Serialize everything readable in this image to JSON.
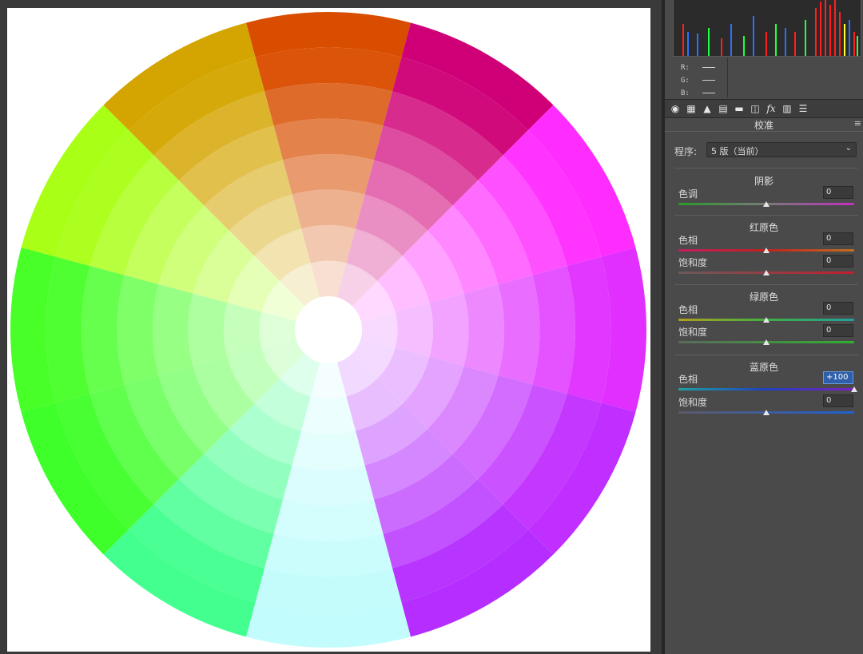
{
  "wheel": {
    "segments": 12,
    "rings": 8,
    "colors": [
      {
        "hue": "orange-red",
        "hex": "#d94d00"
      },
      {
        "hue": "magenta-red",
        "hex": "#cf0077"
      },
      {
        "hue": "magenta",
        "hex": "#ff2cff"
      },
      {
        "hue": "violet",
        "hex": "#e02fff"
      },
      {
        "hue": "purple",
        "hex": "#c02fff"
      },
      {
        "hue": "purple-blue",
        "hex": "#b52dff"
      },
      {
        "hue": "light-cyan",
        "hex": "#c2fcfc"
      },
      {
        "hue": "mint",
        "hex": "#42ff8f"
      },
      {
        "hue": "green",
        "hex": "#3fff2a"
      },
      {
        "hue": "green-2",
        "hex": "#48ff28"
      },
      {
        "hue": "yellow-green",
        "hex": "#aaff17"
      },
      {
        "hue": "mustard",
        "hex": "#d4a500"
      }
    ]
  },
  "histogram": {
    "colors": [
      "#ff2020",
      "#2f6fff",
      "#20ff40",
      "#ffff30"
    ]
  },
  "readout": {
    "r": "R:",
    "g": "G:",
    "b": "B:"
  },
  "toolbar": {
    "icons": [
      "aperture-icon",
      "grid-icon",
      "mountain-icon",
      "split-toning-icon",
      "bars-icon",
      "lens-icon",
      "fx-icon",
      "film-icon",
      "sliders-icon"
    ],
    "glyphs": [
      "◉",
      "▦",
      "▲",
      "▤",
      "▬",
      "◫",
      "fx",
      "▥",
      "☰"
    ]
  },
  "panel": {
    "title": "校准",
    "menu_glyph": "≡",
    "process_label": "程序:",
    "process_value": "5 版（当前）",
    "process_caret": "⌄",
    "shadows": {
      "heading": "阴影",
      "tint_label": "色调",
      "tint_value": "0"
    },
    "red_primary": {
      "heading": "红原色",
      "hue_label": "色相",
      "hue_value": "0",
      "sat_label": "饱和度",
      "sat_value": "0"
    },
    "green_primary": {
      "heading": "绿原色",
      "hue_label": "色相",
      "hue_value": "0",
      "sat_label": "饱和度",
      "sat_value": "0"
    },
    "blue_primary": {
      "heading": "蓝原色",
      "hue_label": "色相",
      "hue_value": "+100",
      "sat_label": "饱和度",
      "sat_value": "0"
    }
  },
  "sliders": {
    "shadow_tint": 0.5,
    "red_hue": 0.5,
    "red_sat": 0.5,
    "green_hue": 0.5,
    "green_sat": 0.5,
    "blue_hue": 1.0,
    "blue_sat": 0.5
  }
}
